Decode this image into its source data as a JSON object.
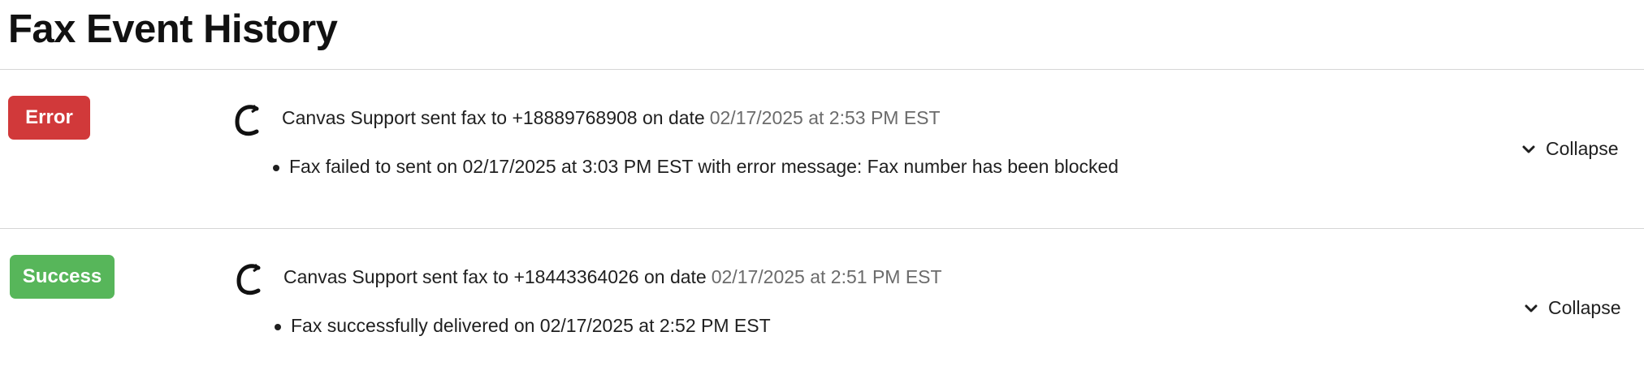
{
  "page": {
    "title": "Fax Event History"
  },
  "events": [
    {
      "status": "Error",
      "status_color": "#d1393a",
      "sender": "Canvas Support",
      "action": "sent fax to +18889768908 on date",
      "date": "02/17/2025 at 2:53 PM EST",
      "details": [
        "Fax failed to sent on 02/17/2025 at 3:03 PM EST with error message: Fax number has been blocked"
      ],
      "toggle_label": "Collapse",
      "logo_icon": "canvas-logo-icon"
    },
    {
      "status": "Success",
      "status_color": "#57b65a",
      "sender": "Canvas Support",
      "action": "sent fax to +18443364026 on date",
      "date": "02/17/2025 at 2:51 PM EST",
      "details": [
        "Fax successfully delivered on 02/17/2025 at 2:52 PM EST"
      ],
      "toggle_label": "Collapse",
      "logo_icon": "canvas-logo-icon"
    }
  ],
  "icons": {
    "toggle": "chevron-down-icon"
  }
}
